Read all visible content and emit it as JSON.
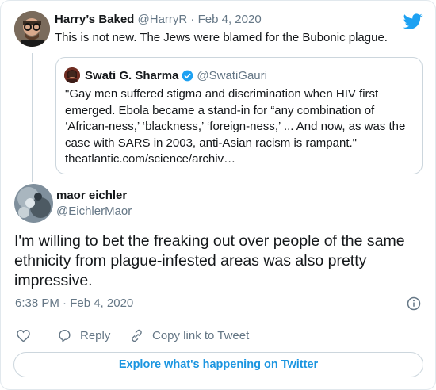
{
  "parent_tweet": {
    "author_name": "Harry’s Baked",
    "author_handle": "@HarryR",
    "separator": "·",
    "date": "Feb 4, 2020",
    "text": "This is not new. The Jews were blamed for the Bubonic plague.",
    "avatar_icon": "person-glasses-avatar"
  },
  "quoted_tweet": {
    "author_name": "Swati G. Sharma",
    "author_handle": "@SwatiGauri",
    "verified": true,
    "text": "\"Gay men suffered stigma and discrimination when HIV first emerged. Ebola became a stand-in for “any combination of ‘African-ness,’ ‘blackness,’ ‘foreign-ness,’ ... And now, as was the case with SARS in 2003, anti-Asian racism is rampant.\" theatlantic.com/science/archiv…"
  },
  "main_tweet": {
    "author_name": "maor eichler",
    "author_handle": "@EichlerMaor",
    "text": "I'm willing to bet the freaking out over people of the same ethnicity from plague-infested areas was also pretty impressive.",
    "timestamp": "6:38 PM · Feb 4, 2020"
  },
  "actions": {
    "like_icon": "heart-icon",
    "reply_label": "Reply",
    "copy_label": "Copy link to Tweet"
  },
  "explore_label": "Explore what's happening on Twitter",
  "colors": {
    "twitter_blue": "#1da1f2",
    "link_blue": "#1b95e0",
    "muted": "#657786",
    "border": "#e1e8ed"
  }
}
